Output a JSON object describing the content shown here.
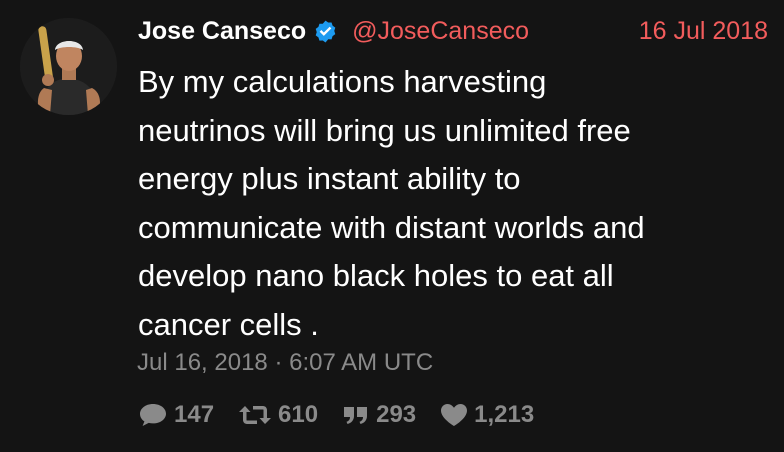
{
  "author": {
    "name": "Jose Canseco",
    "handle": "@JoseCanseco",
    "verified": true
  },
  "header_date": "16 Jul 2018",
  "tweet_lines": [
    "By my calculations harvesting",
    "neutrinos will bring us unlimited free",
    "energy plus instant ability to",
    "communicate with distant worlds and",
    "develop nano black holes to eat all",
    "cancer cells ."
  ],
  "timestamp": "Jul 16, 2018 · 6:07 AM UTC",
  "stats": {
    "replies": "147",
    "retweets": "610",
    "quotes": "293",
    "likes": "1,213"
  },
  "icons": {
    "verified": "verified-badge-icon",
    "replies": "comment-bubble-icon",
    "retweets": "retweet-icon",
    "quotes": "quote-icon",
    "likes": "heart-icon"
  },
  "colors": {
    "background": "#141414",
    "accent": "#f25c5c",
    "verified": "#1d9bf0",
    "muted": "#8a8a8a",
    "text": "#ffffff"
  }
}
